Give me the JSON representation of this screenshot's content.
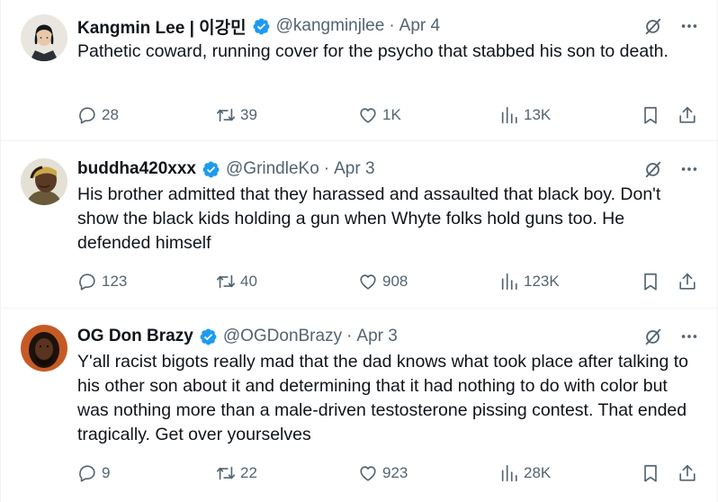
{
  "colors": {
    "verified": "#1d9bf0",
    "text_primary": "#0f1419",
    "text_secondary": "#536471",
    "divider": "#eff3f4"
  },
  "icons": {
    "verified": "verified-badge-icon",
    "grok": "grok-icon",
    "more": "more-options-icon",
    "reply": "reply-icon",
    "repost": "repost-icon",
    "like": "like-icon",
    "views": "views-icon",
    "bookmark": "bookmark-icon",
    "share": "share-icon"
  },
  "tweets": [
    {
      "name": "Kangmin Lee | 이강민",
      "handle": "@kangminjlee",
      "separator": "·",
      "date": "Apr 4",
      "text": "Pathetic coward, running cover for the psycho that stabbed his son to death.",
      "replies": "28",
      "reposts": "39",
      "likes": "1K",
      "views": "13K"
    },
    {
      "name": "buddha420xxx",
      "handle": "@GrindleKo",
      "separator": "·",
      "date": "Apr 3",
      "text": "His brother admitted that they harassed and assaulted that black boy. Don't show the black kids holding a gun when Whyte folks hold guns too. He defended himself",
      "replies": "123",
      "reposts": "40",
      "likes": "908",
      "views": "123K"
    },
    {
      "name": "OG Don Brazy",
      "handle": "@OGDonBrazy",
      "separator": "·",
      "date": "Apr 3",
      "text": "Y'all racist bigots really mad that the dad knows what took place after talking to his other son about it and determining that it had nothing to do with color but was nothing more than a male-driven testosterone pissing contest. That ended tragically. Get over yourselves",
      "replies": "9",
      "reposts": "22",
      "likes": "923",
      "views": "28K"
    }
  ]
}
